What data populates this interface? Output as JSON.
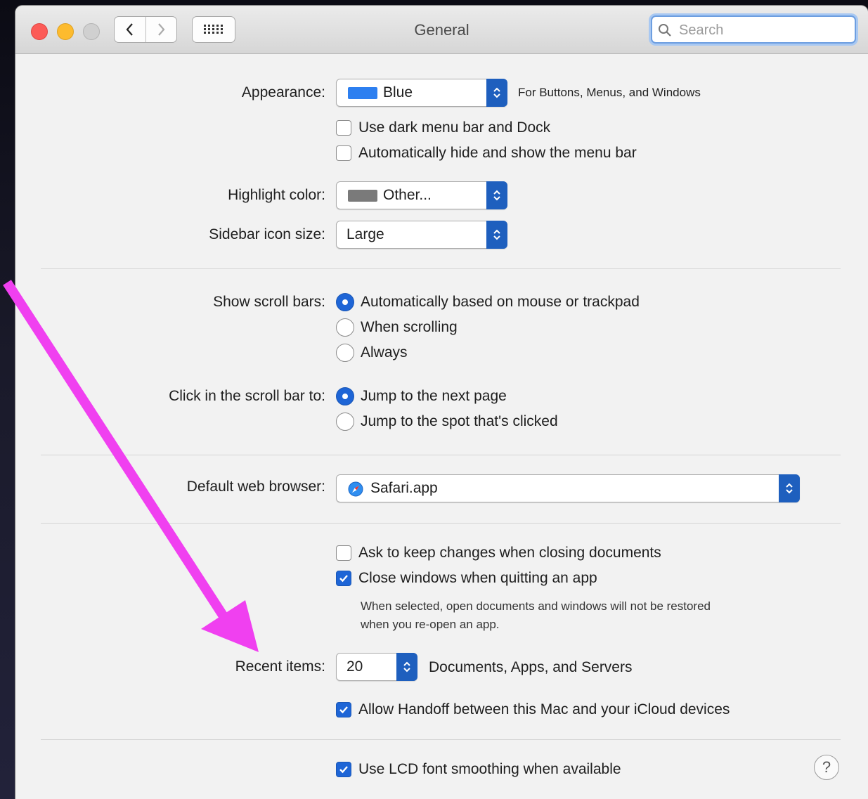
{
  "window": {
    "title": "General"
  },
  "toolbar": {
    "search_placeholder": "Search"
  },
  "appearance": {
    "label": "Appearance:",
    "value": "Blue",
    "swatch_color": "#2d7ff0",
    "hint": "For Buttons, Menus, and Windows",
    "dark_menu": {
      "label": "Use dark menu bar and Dock",
      "checked": false
    },
    "auto_hide_menu": {
      "label": "Automatically hide and show the menu bar",
      "checked": false
    }
  },
  "highlight": {
    "label": "Highlight color:",
    "value": "Other...",
    "swatch_color": "#7a7a7a"
  },
  "sidebar_icon_size": {
    "label": "Sidebar icon size:",
    "value": "Large"
  },
  "scroll_bars": {
    "label": "Show scroll bars:",
    "options": [
      "Automatically based on mouse or trackpad",
      "When scrolling",
      "Always"
    ],
    "selected_index": 0
  },
  "click_scroll": {
    "label": "Click in the scroll bar to:",
    "options": [
      "Jump to the next page",
      "Jump to the spot that's clicked"
    ],
    "selected_index": 0
  },
  "browser": {
    "label": "Default web browser:",
    "value": "Safari.app"
  },
  "documents": {
    "ask_keep_changes": {
      "label": "Ask to keep changes when closing documents",
      "checked": false
    },
    "close_windows": {
      "label": "Close windows when quitting an app",
      "checked": true
    },
    "note_line1": "When selected, open documents and windows will not be restored",
    "note_line2": "when you re-open an app."
  },
  "recent_items": {
    "label": "Recent items:",
    "value": "20",
    "suffix": "Documents, Apps, and Servers"
  },
  "handoff": {
    "label": "Allow Handoff between this Mac and your iCloud devices",
    "checked": true
  },
  "lcd_smoothing": {
    "label": "Use LCD font smoothing when available",
    "checked": true
  },
  "help": {
    "glyph": "?"
  },
  "colors": {
    "accent": "#1e65d6",
    "annotation_arrow": "#f040f0"
  }
}
